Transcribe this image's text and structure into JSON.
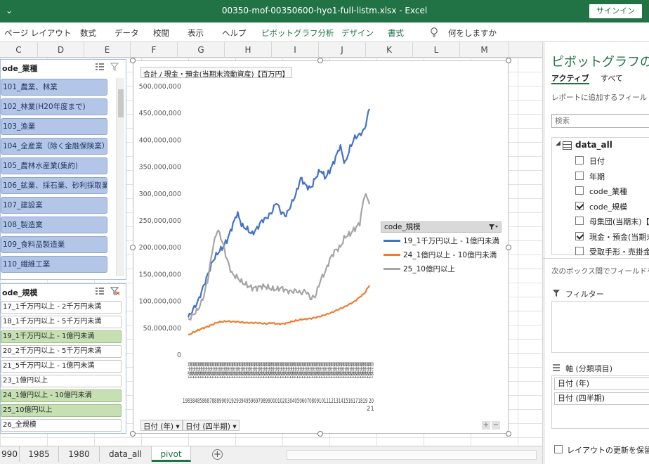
{
  "window": {
    "quick_access": "⌄",
    "title": "00350-mof-00350600-hyo1-full-listm.xlsx  -  Excel",
    "signin": "サインイン"
  },
  "ribbon": {
    "tabs": [
      "ページ レイアウト",
      "数式",
      "データ",
      "校閲",
      "表示",
      "ヘルプ",
      "ピボットグラフ分析",
      "デザイン",
      "書式"
    ],
    "contextual_tabs": [
      "ピボットグラフ分析",
      "デザイン",
      "書式"
    ],
    "tell_me": "何をしますか"
  },
  "columns": [
    "C",
    "D",
    "E",
    "F",
    "G",
    "H",
    "I",
    "J",
    "K",
    "L",
    "M"
  ],
  "slicer_industry": {
    "title": "ode_業種",
    "items": [
      "101_農業、林業",
      "102_林業(H20年度まで)",
      "103_漁業",
      "104_全産業（除く金融保険業）",
      "105_農林水産業(集約)",
      "106_鉱業、採石業、砂利採取業",
      "107_建設業",
      "108_製造業",
      "109_食料品製造業",
      "110_繊維工業"
    ]
  },
  "slicer_size": {
    "title": "ode_規模",
    "items": [
      {
        "label": "17_1千万円以上 - 2千万円未満",
        "selected": false
      },
      {
        "label": "18_1千万円以上 - 5千万円未満",
        "selected": false
      },
      {
        "label": "19_1千万円以上 - 1億円未満",
        "selected": true
      },
      {
        "label": "20_2千万円以上 - 5千万円未満",
        "selected": false
      },
      {
        "label": "21_5千万円以上 - 1億円未満",
        "selected": false
      },
      {
        "label": "23_1億円以上",
        "selected": false
      },
      {
        "label": "24_1億円以上 - 10億円未満",
        "selected": true
      },
      {
        "label": "25_10億円以上",
        "selected": true
      },
      {
        "label": "26_全規模",
        "selected": false
      }
    ]
  },
  "chart": {
    "value_field": "合計 / 現金・預金(当期末流動資産)【百万円】",
    "axis_buttons": [
      "日付 (年)",
      "日付 (四半期)"
    ],
    "zoom_plus": "+",
    "zoom_minus": "−",
    "legend_field": "code_規模",
    "x_tick_sample": "四半期1",
    "x_year_row": "1983848586878889909192939495969798990001020304050607080910111213141516171819 20",
    "x_year_end": "21"
  },
  "chart_data": {
    "type": "line",
    "title": "",
    "ylabel": "",
    "xlabel": "",
    "ylim": [
      0,
      500000000
    ],
    "y_ticks": [
      "0",
      "50,000,000",
      "100,000,000",
      "150,000,000",
      "200,000,000",
      "250,000,000",
      "300,000,000",
      "350,000,000",
      "400,000,000",
      "450,000,000",
      "500,000,000"
    ],
    "x_range": [
      "1983 四半期1",
      "2021 四半期1"
    ],
    "grid": true,
    "legend": "right",
    "series": [
      {
        "name": "19_1千万円以上 - 1億円未満",
        "color": "#4472c4",
        "values": [
          70000000,
          85000000,
          100000000,
          125000000,
          150000000,
          175000000,
          190000000,
          200000000,
          215000000,
          240000000,
          265000000,
          240000000,
          235000000,
          225000000,
          235000000,
          250000000,
          255000000,
          265000000,
          285000000,
          265000000,
          260000000,
          280000000,
          300000000,
          330000000,
          315000000,
          310000000,
          330000000,
          345000000,
          330000000,
          345000000,
          365000000,
          390000000,
          355000000,
          385000000,
          405000000,
          410000000,
          420000000,
          460000000
        ]
      },
      {
        "name": "24_1億円以上 - 10億円未満",
        "color": "#ed7d31",
        "values": [
          37000000,
          42000000,
          46000000,
          50000000,
          53000000,
          57000000,
          61000000,
          62000000,
          63000000,
          62000000,
          62000000,
          61000000,
          60000000,
          60000000,
          60000000,
          59000000,
          58000000,
          60000000,
          58000000,
          58000000,
          59000000,
          62000000,
          64000000,
          66000000,
          67000000,
          68000000,
          70000000,
          72000000,
          75000000,
          78000000,
          82000000,
          86000000,
          90000000,
          95000000,
          100000000,
          108000000,
          115000000,
          130000000
        ]
      },
      {
        "name": "25_10億円以上",
        "color": "#a5a5a5",
        "values": [
          65000000,
          75000000,
          85000000,
          105000000,
          140000000,
          200000000,
          235000000,
          210000000,
          175000000,
          150000000,
          145000000,
          135000000,
          130000000,
          125000000,
          125000000,
          128000000,
          127000000,
          123000000,
          122000000,
          125000000,
          120000000,
          118000000,
          120000000,
          115000000,
          120000000,
          105000000,
          110000000,
          140000000,
          155000000,
          180000000,
          195000000,
          200000000,
          220000000,
          225000000,
          235000000,
          245000000,
          300000000,
          285000000
        ]
      }
    ]
  },
  "sheet_tabs": [
    "990",
    "1985",
    "1980",
    "data_all",
    "pivot"
  ],
  "active_sheet": "pivot",
  "add_sheet": "+",
  "pane": {
    "title": "ピボットグラフのフィ",
    "tab_active": "アクティブ",
    "tab_all": "すべて",
    "hint": "レポートに追加するフィールドを選",
    "search_placeholder": "検索",
    "table_name": "data_all",
    "expand": "◢",
    "fields": [
      {
        "label": "日付",
        "checked": false
      },
      {
        "label": "年期",
        "checked": false
      },
      {
        "label": "code_業種",
        "checked": false
      },
      {
        "label": "code_規模",
        "checked": true
      },
      {
        "label": "母集団(当期末)【社",
        "checked": false
      },
      {
        "label": "現金・預金(当期末",
        "checked": true
      },
      {
        "label": "受取手形・売掛金(",
        "checked": false
      }
    ],
    "hint2": "次のボックス間でフィールドをドラ",
    "filter_title": "フィルター",
    "axis_title": "軸 (分類項目)",
    "axis_items": [
      "日付 (年)",
      "日付 (四半期)"
    ],
    "defer_label": "レイアウトの更新を保留する"
  }
}
